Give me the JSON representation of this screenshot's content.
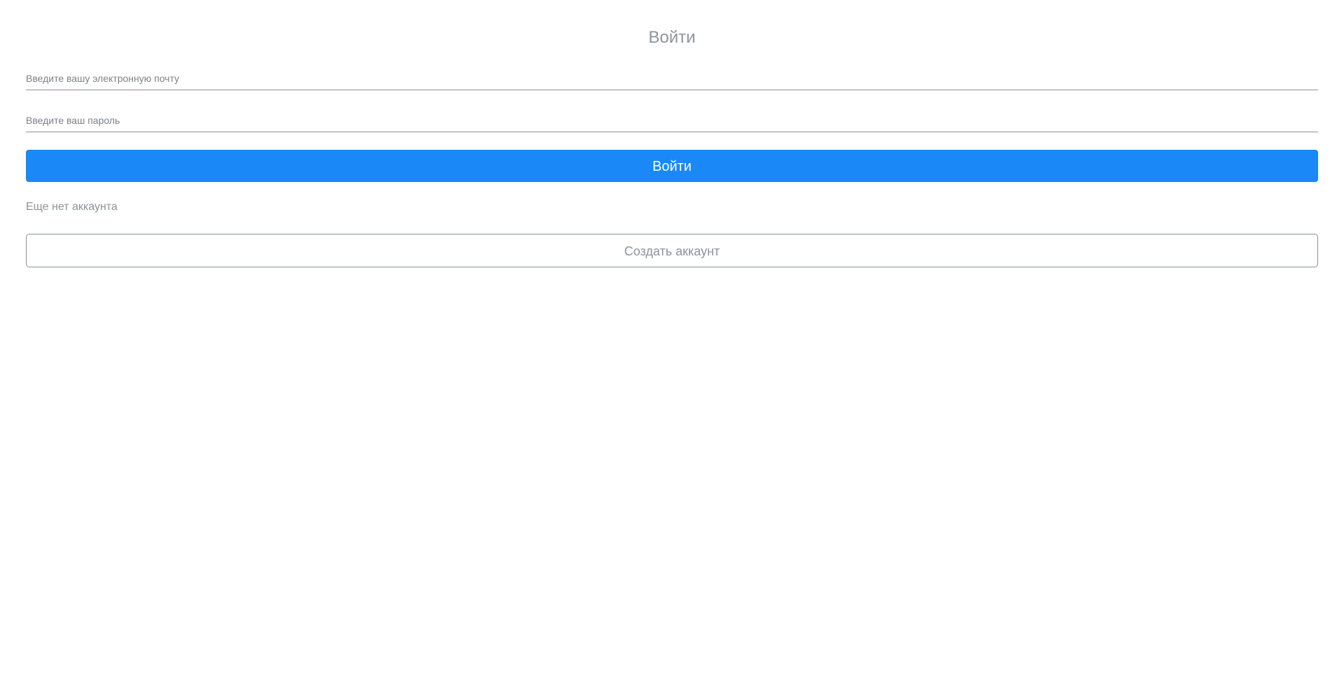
{
  "login_form": {
    "title": "Войти",
    "email_field": {
      "value": "",
      "placeholder": "Введите вашу электронную почту"
    },
    "password_field": {
      "value": "",
      "placeholder": "Введите ваш пароль"
    },
    "submit_label": "Войти",
    "no_account_text": "Еще нет аккаунта",
    "create_account_label": "Создать аккаунт"
  },
  "colors": {
    "primary": "#1a88f6",
    "muted_text": "#8c949c",
    "border": "#8a9097"
  }
}
